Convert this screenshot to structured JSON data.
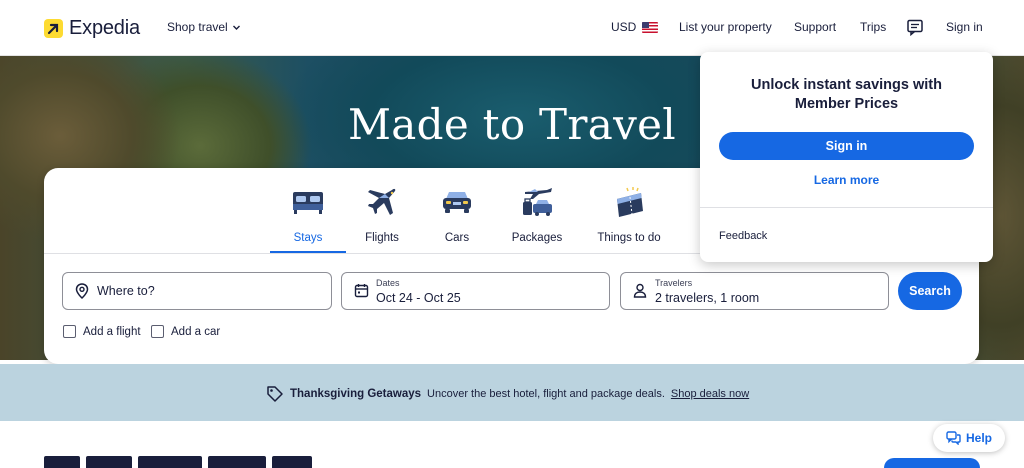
{
  "header": {
    "brand": "Expedia",
    "shop_travel": "Shop travel",
    "currency": "USD",
    "list_property": "List your property",
    "support": "Support",
    "trips": "Trips",
    "sign_in": "Sign in"
  },
  "hero": {
    "title": "Made to Travel"
  },
  "tabs": [
    {
      "label": "Stays",
      "icon": "bed-icon",
      "active": true
    },
    {
      "label": "Flights",
      "icon": "airplane-icon",
      "active": false
    },
    {
      "label": "Cars",
      "icon": "car-icon",
      "active": false
    },
    {
      "label": "Packages",
      "icon": "packages-icon",
      "active": false
    },
    {
      "label": "Things to do",
      "icon": "ticket-icon",
      "active": false
    }
  ],
  "search": {
    "destination_placeholder": "Where to?",
    "dates_label": "Dates",
    "dates_value": "Oct 24 - Oct 25",
    "travelers_label": "Travelers",
    "travelers_value": "2 travelers, 1 room",
    "search_button": "Search",
    "add_flight": "Add a flight",
    "add_car": "Add a car"
  },
  "popover": {
    "title_line1": "Unlock instant savings with",
    "title_line2": "Member Prices",
    "sign_in": "Sign in",
    "learn_more": "Learn more",
    "feedback": "Feedback"
  },
  "banner": {
    "title": "Thanksgiving Getaways",
    "text": "Uncover the best hotel, flight and package deals.",
    "link": "Shop deals now"
  },
  "help": {
    "label": "Help"
  },
  "colors": {
    "accent": "#1668e3",
    "brand_yellow": "#fddb32",
    "text": "#191e3b",
    "banner_bg": "#bbd3df"
  }
}
